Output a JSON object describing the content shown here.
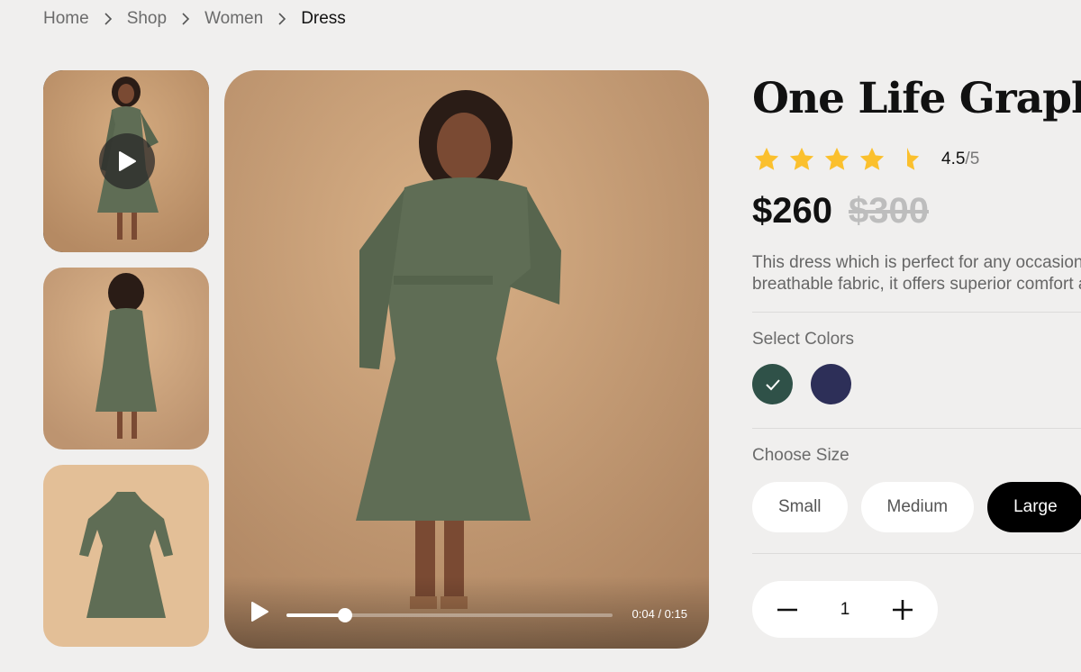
{
  "breadcrumb": [
    "Home",
    "Shop",
    "Women",
    "Dress"
  ],
  "product": {
    "title": "One Life Graphic T-shirt",
    "rating": "4.5",
    "rating_max": "/5",
    "stars_filled_fraction": 0.9,
    "price": "$260",
    "old_price": "$300",
    "description_line1": "This dress which is perfect for any occasion. Crafted from a soft and",
    "description_line2": "breathable fabric, it offers superior comfort and style."
  },
  "video": {
    "time": "0:04 / 0:15",
    "progress": 0.18
  },
  "colors": {
    "label": "Select Colors",
    "options": [
      {
        "name": "green",
        "hex": "#2f5148",
        "selected": true
      },
      {
        "name": "navy",
        "hex": "#2d2f58",
        "selected": false
      }
    ]
  },
  "sizes": {
    "label": "Choose Size",
    "options": [
      "Small",
      "Medium",
      "Large"
    ],
    "selected": "Large"
  },
  "quantity": {
    "value": "1"
  },
  "colors_theme": {
    "accent": "#000000",
    "star": "#fbc02d",
    "background": "#f0efee"
  },
  "icons": [
    "chevron-right-icon",
    "play-icon",
    "star-icon",
    "half-star-icon",
    "check-icon",
    "minus-icon",
    "plus-icon"
  ]
}
